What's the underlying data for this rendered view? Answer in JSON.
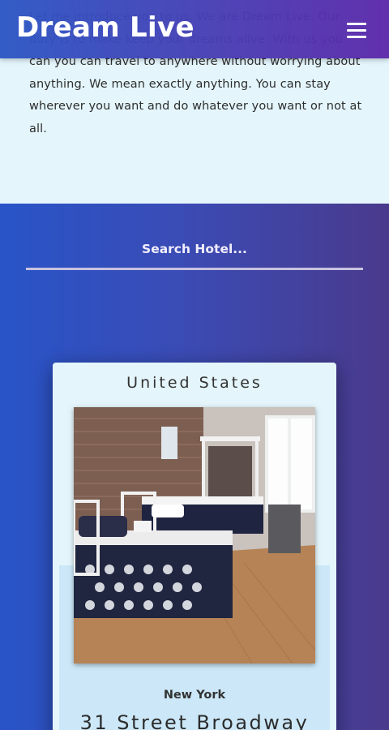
{
  "header": {
    "logo": "Dream Live",
    "menu_icon": "hamburger-menu-icon"
  },
  "intro": {
    "text": "Let me introduce you to us. We are Dream Live. Our duty is to make keep your dreams alive. With us you can you can travel to anywhere without worrying about anything. We mean exactly anything. You can stay wherever you want and do whatever you want or not at all."
  },
  "search": {
    "placeholder": "Search Hotel..."
  },
  "hotel_card": {
    "country": "United States",
    "city": "New York",
    "street": "31 Street Broadway"
  },
  "colors": {
    "header_gradient": [
      "#2c56c4",
      "#5c28aa"
    ],
    "section_gradient": [
      "#2854c8",
      "#4a3a8c"
    ],
    "card_bg": "#e4f5fb",
    "intro_bg": "#e4f6fc"
  }
}
